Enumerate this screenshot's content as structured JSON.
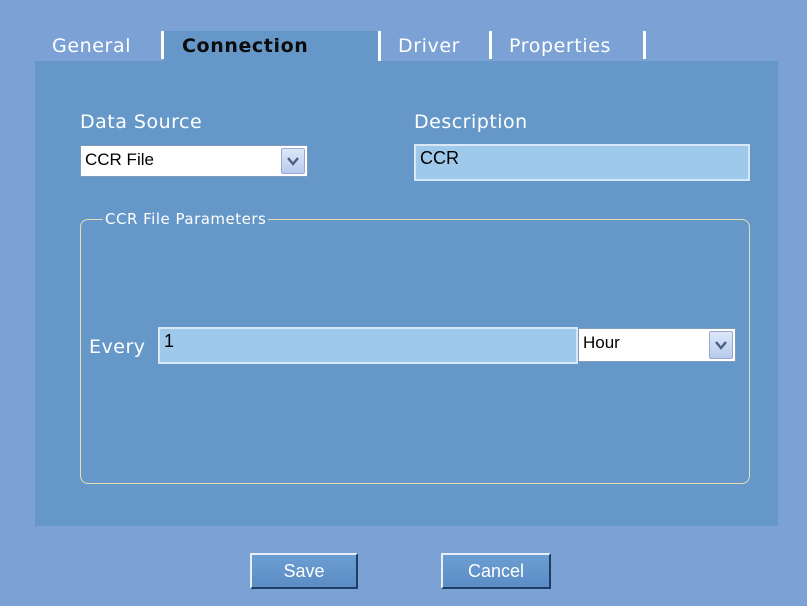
{
  "tabs": [
    {
      "label": "General"
    },
    {
      "label": "Connection",
      "active": true
    },
    {
      "label": "Driver"
    },
    {
      "label": "Properties"
    }
  ],
  "data_source": {
    "label": "Data Source",
    "value": "CCR File"
  },
  "description": {
    "label": "Description",
    "value": "CCR"
  },
  "parameters": {
    "legend": "CCR File Parameters",
    "every_label": "Every",
    "every_value": "1",
    "unit_value": "Hour"
  },
  "buttons": {
    "save": "Save",
    "cancel": "Cancel"
  },
  "icons": {
    "dropdown": "chevron-down-icon"
  },
  "colors": {
    "background": "#7ba1d5",
    "panel": "#6598c9",
    "input": "#9fc9ea"
  }
}
